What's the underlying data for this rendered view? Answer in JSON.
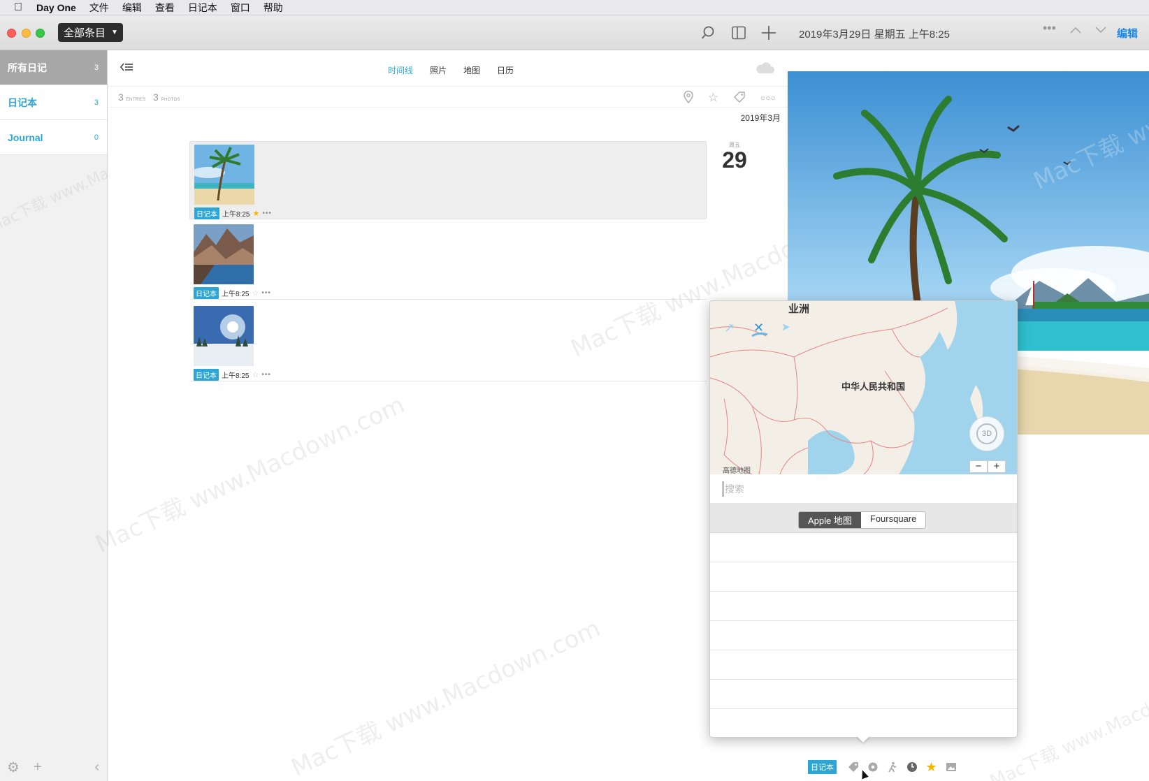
{
  "menubar": {
    "app_name": "Day One",
    "items": [
      "文件",
      "编辑",
      "查看",
      "日记本",
      "窗口",
      "帮助"
    ]
  },
  "toolbar": {
    "filter_label": "全部条目",
    "datetime": "2019年3月29日 星期五 上午8:25",
    "edit_label": "编辑"
  },
  "sidebar": {
    "items": [
      {
        "label": "所有日记",
        "count": "3",
        "active": true
      },
      {
        "label": "日记本",
        "count": "3",
        "active": false
      },
      {
        "label": "Journal",
        "count": "0",
        "active": false
      }
    ]
  },
  "list": {
    "tabs": [
      {
        "label": "时间线",
        "active": true
      },
      {
        "label": "照片",
        "active": false
      },
      {
        "label": "地图",
        "active": false
      },
      {
        "label": "日历",
        "active": false
      }
    ],
    "stats": {
      "entries_count": "3",
      "entries_label": "ENTRIES",
      "photos_count": "3",
      "photos_label": "PHOTOS"
    },
    "month_label": "2019年3月",
    "day": {
      "weekday": "周五",
      "number": "29"
    },
    "entries": [
      {
        "journal": "日记本",
        "time": "上午8:25",
        "starred": true,
        "thumb": "palm-beach"
      },
      {
        "journal": "日记本",
        "time": "上午8:25",
        "starred": false,
        "thumb": "mountain-lake"
      },
      {
        "journal": "日记本",
        "time": "上午8:25",
        "starred": false,
        "thumb": "snow-field"
      }
    ]
  },
  "watermark": {
    "text": "Mac下载 www.Macdown.com"
  },
  "location_popover": {
    "map": {
      "label_region": "业洲",
      "label_country": "中华人民共和国",
      "attribution": "高德地图",
      "compass_label": "3D",
      "zoom_out": "−",
      "zoom_in": "+"
    },
    "search_placeholder": "搜索",
    "sources": [
      {
        "label": "Apple 地图",
        "active": true
      },
      {
        "label": "Foursquare",
        "active": false
      }
    ]
  },
  "bottombar": {
    "journal_tag": "日记本",
    "icons": [
      "tag-icon",
      "location-icon",
      "activity-icon",
      "clock-icon",
      "star-icon",
      "photo-icon"
    ]
  },
  "colors": {
    "accent": "#2ea6d5",
    "star": "#f5b400",
    "edit": "#1e88e5"
  }
}
